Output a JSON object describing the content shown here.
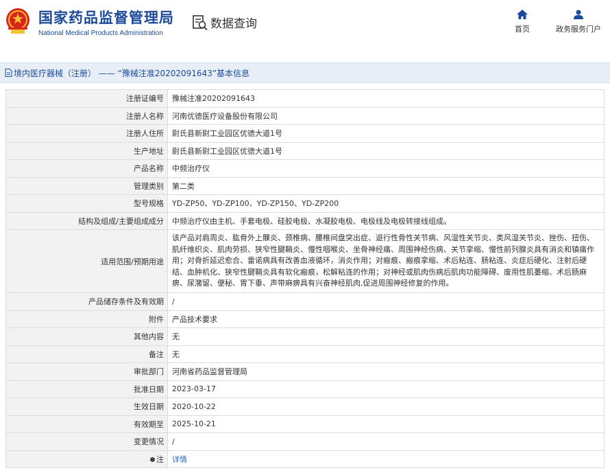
{
  "header": {
    "brand_cn": "国家药品监督管理局",
    "brand_en": "National Medical Products Administration",
    "data_query_label": "数据查询",
    "nav": [
      {
        "label": "首页",
        "icon": "home-icon"
      },
      {
        "label": "政务服务门户",
        "icon": "user-icon"
      }
    ],
    "brand_color": "#1b4a9c"
  },
  "titlebar": {
    "text": "境内医疗器械（注册） —— “豫械注准20202091643”基本信息"
  },
  "rows": [
    {
      "key": "注册证编号",
      "value": "豫械注准20202091643"
    },
    {
      "key": "注册人名称",
      "value": "河南优德医疗设备股份有限公司"
    },
    {
      "key": "注册人住所",
      "value": "尉氏县新尉工业园区优德大道1号"
    },
    {
      "key": "生产地址",
      "value": "尉氏县新尉工业园区优德大道1号"
    },
    {
      "key": "产品名称",
      "value": "中频治疗仪"
    },
    {
      "key": "管理类别",
      "value": "第二类"
    },
    {
      "key": "型号规格",
      "value": "YD-ZP50、YD-ZP100、YD-ZP150、YD-ZP200"
    },
    {
      "key": "结构及组成/主要组成成分",
      "value": "中频治疗仪由主机、手套电极、硅胶电极、水凝胶电极、电极线及电极转接线组成。"
    },
    {
      "key": "适用范围/预期用途",
      "value": "该产品对肩周炎、肱骨外上髁炎、颈椎病、腰椎间盘突出症、退行性骨性关节病、风湿性关节炎、类风湿关节炎、挫伤、扭伤、肌纤维织炎、肌肉劳损、狭窄性腱鞘炎、慢性咽喉炎、坐骨神经痛、周围神经伤病、关节挛缩、慢性前列腺炎具有消炎和镇痛作用；对骨折延迟愈合、雷诺病具有改善血液循环，消炎作用；对瘢痕、瘢痕挛缩、术后粘连、肠粘连、炎症后硬化、注射后硬结、血肿机化、狭窄性腱鞘炎具有软化瘢痕，松解粘连的作用；对神经或肌肉伤病后肌肉功能障碍、废用性肌萎缩、术后肠麻痹、尿潴留、便秘、胃下垂、声带麻痹具有兴奋神经肌肉,促进周围神经修复的作用。"
    },
    {
      "key": "产品储存条件及有效期",
      "value": "/"
    },
    {
      "key": "附件",
      "value": "产品技术要求"
    },
    {
      "key": "其他内容",
      "value": "无"
    },
    {
      "key": "备注",
      "value": "无"
    },
    {
      "key": "审批部门",
      "value": "河南省药品监督管理局"
    },
    {
      "key": "批准日期",
      "value": "2023-03-17"
    },
    {
      "key": "生效日期",
      "value": "2020-10-22"
    },
    {
      "key": "有效期至",
      "value": "2025-10-21"
    },
    {
      "key": "变更情况",
      "value": "/"
    },
    {
      "key": "注",
      "value": "详情"
    }
  ]
}
